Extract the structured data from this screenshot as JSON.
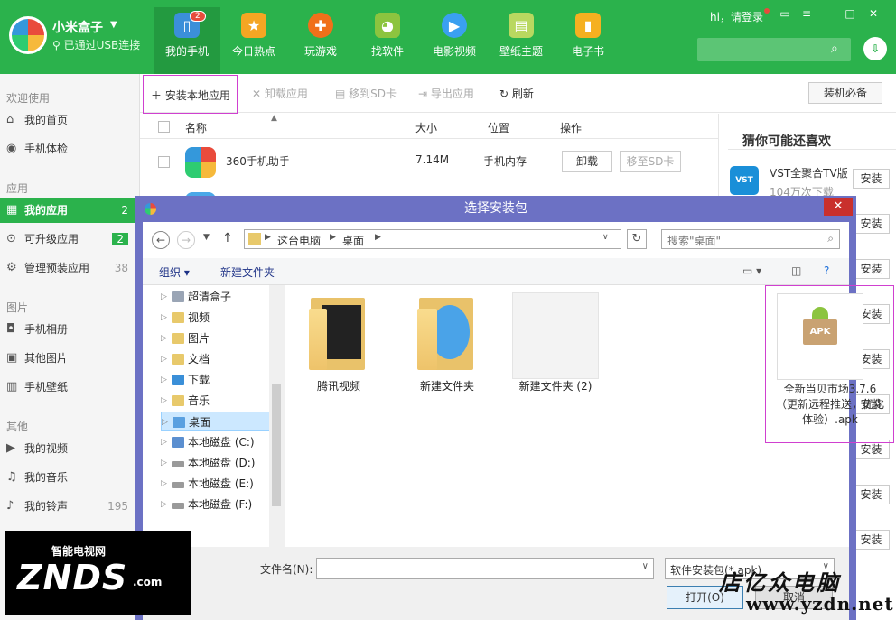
{
  "app": {
    "name": "小米盒子",
    "status": "已通过USB连接"
  },
  "nav": {
    "badge": "2",
    "tabs": [
      {
        "label": "我的手机",
        "icon": "phone-icon",
        "color": "#3b8fd9"
      },
      {
        "label": "今日热点",
        "icon": "star-icon",
        "color": "#f5a623"
      },
      {
        "label": "玩游戏",
        "icon": "gamepad-icon",
        "color": "#f0701a"
      },
      {
        "label": "找软件",
        "icon": "android-icon",
        "color": "#8cc43f"
      },
      {
        "label": "电影视频",
        "icon": "play-icon",
        "color": "#3aa0f0"
      },
      {
        "label": "壁纸主题",
        "icon": "wallpaper-icon",
        "color": "#b9d860"
      },
      {
        "label": "电子书",
        "icon": "book-icon",
        "color": "#f5b020"
      }
    ]
  },
  "header": {
    "login_text": "hi，请登录"
  },
  "sidebar": {
    "groups": [
      "欢迎使用",
      "应用",
      "图片",
      "其他"
    ],
    "items": [
      {
        "label": "我的首页",
        "count": ""
      },
      {
        "label": "手机体检",
        "count": ""
      },
      {
        "label": "我的应用",
        "count": "2"
      },
      {
        "label": "可升级应用",
        "count": "2"
      },
      {
        "label": "管理预装应用",
        "count": "38"
      },
      {
        "label": "手机相册",
        "count": ""
      },
      {
        "label": "其他图片",
        "count": ""
      },
      {
        "label": "手机壁纸",
        "count": ""
      },
      {
        "label": "我的视频",
        "count": ""
      },
      {
        "label": "我的音乐",
        "count": ""
      },
      {
        "label": "我的铃声",
        "count": "195"
      }
    ]
  },
  "toolbar": {
    "install_local": "安装本地应用",
    "uninstall": "卸载应用",
    "move_sd": "移到SD卡",
    "export": "导出应用",
    "refresh": "刷新",
    "essentials": "装机必备"
  },
  "applist": {
    "headers": {
      "name": "名称",
      "size": "大小",
      "location": "位置",
      "action": "操作"
    },
    "rows": [
      {
        "name": "360手机助手",
        "size": "7.14M",
        "location": "手机内存",
        "btn1": "卸载",
        "btn2": "移至SD卡"
      }
    ]
  },
  "recommend": {
    "title": "猜你可能还喜欢",
    "first_name": "VST全聚合TV版",
    "first_downloads": "104万次下载",
    "first_icon_text": "VST",
    "install_label": "安装"
  },
  "dialog": {
    "title": "选择安装包",
    "path": [
      "这台电脑",
      "桌面"
    ],
    "search_placeholder": "搜索\"桌面\"",
    "organize": "组织",
    "new_folder": "新建文件夹",
    "tree": [
      "超清盒子",
      "视频",
      "图片",
      "文档",
      "下载",
      "音乐",
      "桌面",
      "本地磁盘 (C:)",
      "本地磁盘 (D:)",
      "本地磁盘 (E:)",
      "本地磁盘 (F:)"
    ],
    "files": [
      {
        "name": "腾讯视频"
      },
      {
        "name": "新建文件夹"
      },
      {
        "name": "新建文件夹 (2)"
      },
      {
        "name": "全新当贝市场3.7.6（更新远程推送，优化体验）.apk"
      }
    ],
    "apk_label": "APK",
    "filename_label": "文件名(N):",
    "filter_value": "软件安装包(*.apk)",
    "open_label": "打开(O)",
    "cancel_label": "取消"
  },
  "watermark": {
    "znds_top": "智能电视网",
    "znds_main": "ZNDS",
    "znds_com": ".com",
    "yz_title": "店亿众电脑",
    "yz_url": "www.yzdn.net"
  }
}
